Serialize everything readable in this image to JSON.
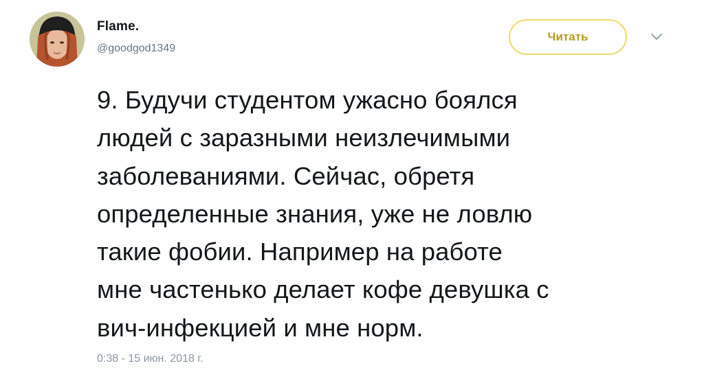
{
  "author": {
    "display_name": "Flame.",
    "handle": "@goodgod1349"
  },
  "follow_button": {
    "label": "Читать"
  },
  "tweet": {
    "text": "9. Будучи студентом ужасно боялся\nлюдей с заразными неизлечимыми\nзаболеваниями. Сейчас, обретя\nопределенные знания, уже не ловлю\nтакие фобии. Например на работе\nмне частенько делает кофе девушка с\nвич-инфекцией и мне норм.",
    "timestamp": "0:38 - 15 июн. 2018 г."
  },
  "icons": {
    "more": "chevron-down-icon",
    "avatar": "avatar-image"
  },
  "colors": {
    "accent": "#b59a1e",
    "button_border": "#f0d96a",
    "text": "#14171a",
    "muted": "#657786"
  }
}
